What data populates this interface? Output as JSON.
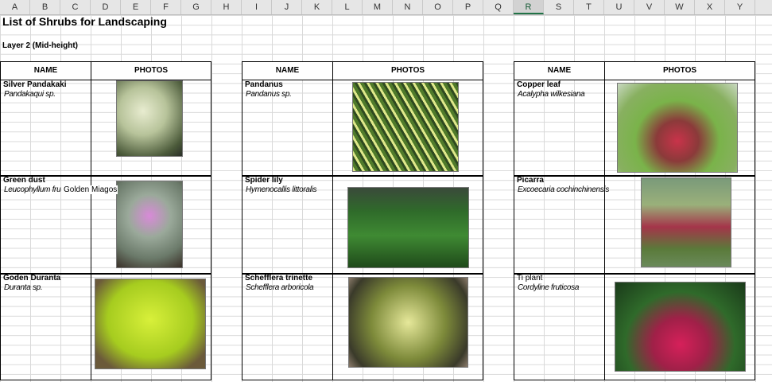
{
  "columns": [
    "A",
    "B",
    "C",
    "D",
    "E",
    "F",
    "G",
    "H",
    "I",
    "J",
    "K",
    "L",
    "M",
    "N",
    "O",
    "P",
    "Q",
    "R",
    "S",
    "T",
    "U",
    "V",
    "W",
    "X",
    "Y"
  ],
  "selected_column": "R",
  "title": "List of Shrubs for Landscaping",
  "subtitle": "Layer 2 (Mid-height)",
  "table_headers": {
    "name": "NAME",
    "photos": "PHOTOS"
  },
  "overflow_text": "Golden Miagos",
  "plants": [
    {
      "name": "Silver Pandakaki",
      "scientific": "Pandakaqui sp."
    },
    {
      "name": "Green dust",
      "scientific": "Leucophyllum fru"
    },
    {
      "name": "Goden Duranta",
      "scientific": "Duranta sp."
    },
    {
      "name": "Pandanus",
      "scientific": "Pandanus sp."
    },
    {
      "name": "Spider lily",
      "scientific": "Hymenocallis littoralis"
    },
    {
      "name": "Schefflera trinette",
      "scientific": "Schefflera arboricola"
    },
    {
      "name": "Copper leaf",
      "scientific": "Acalypha wilkesiana"
    },
    {
      "name": "Picarra",
      "scientific": "Excoecaria cochinchinensis"
    },
    {
      "name": "Ti plant",
      "scientific": "Cordyline fruticosa"
    }
  ]
}
